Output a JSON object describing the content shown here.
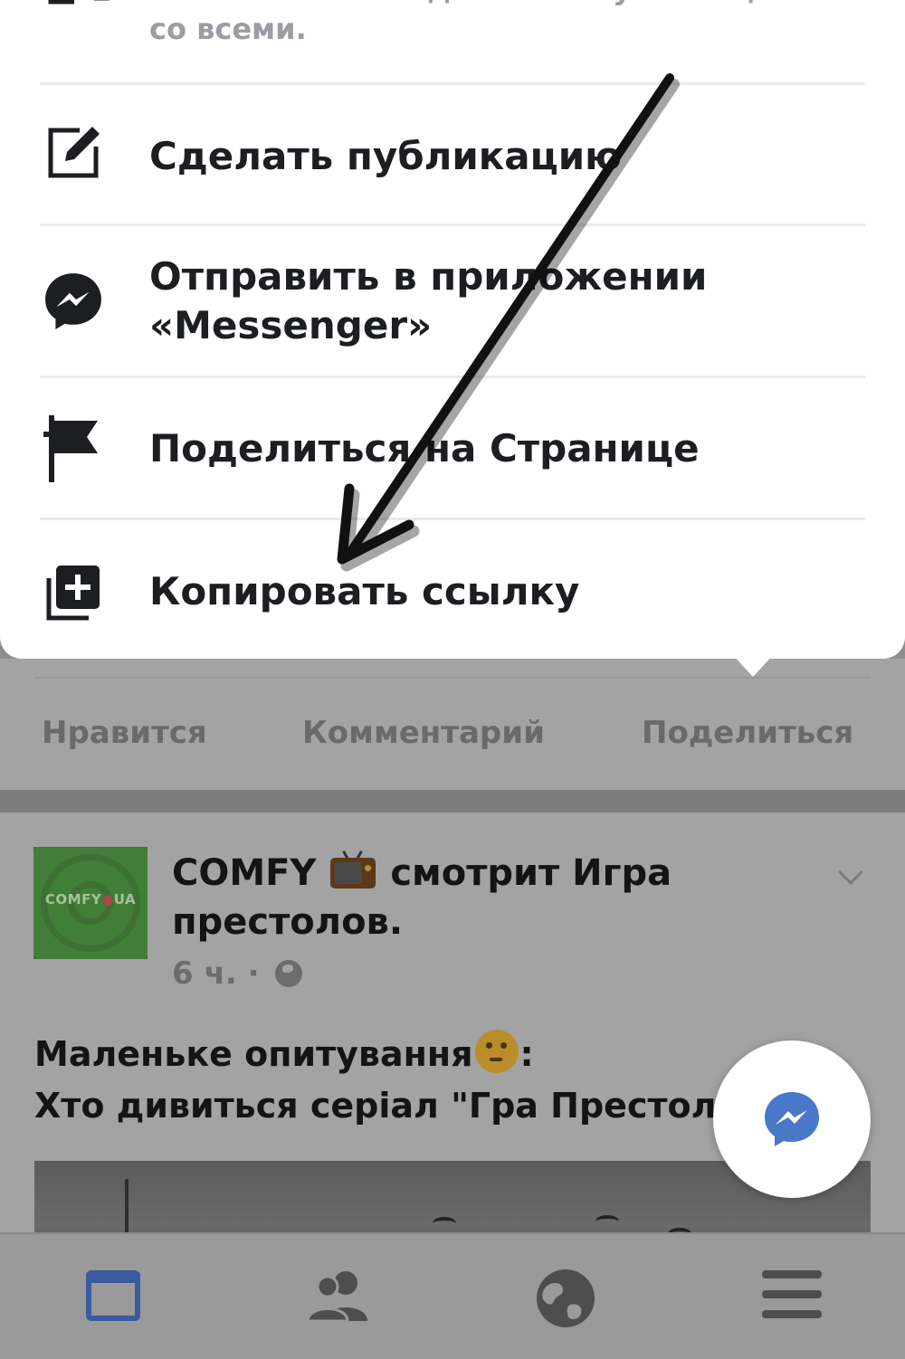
{
  "share_sheet": {
    "top_option": {
      "line1": "Моментально поделиться публикацией",
      "line2": "со всеми."
    },
    "options": [
      {
        "label": "Сделать публикацию",
        "icon": "compose-icon"
      },
      {
        "label_line1": "Отправить в приложении",
        "label_line2": "«Messenger»",
        "icon": "messenger-icon"
      },
      {
        "label": "Поделиться на Странице",
        "icon": "flag-icon"
      },
      {
        "label": "Копировать ссылку",
        "icon": "copy-link-icon"
      }
    ]
  },
  "post_actions": {
    "like": "Нравится",
    "comment": "Комментарий",
    "share": "Поделиться"
  },
  "post": {
    "author": "COMFY",
    "activity": "смотрит Игра престолов.",
    "time": "6 ч. ·",
    "avatar_text": "COMFY",
    "avatar_text_suffix": "UA",
    "text_line1": "Маленьке опитування",
    "text_line1_end": ":",
    "text_line2": "Хто дивиться серіал \"Гра Престолів\"?"
  },
  "tabs": [
    "news-feed-icon",
    "friends-icon",
    "globe-icon",
    "menu-icon"
  ],
  "colors": {
    "accent": "#4267b2",
    "sheet_bg": "#ffffff",
    "overlay": "#8e8e8e"
  }
}
